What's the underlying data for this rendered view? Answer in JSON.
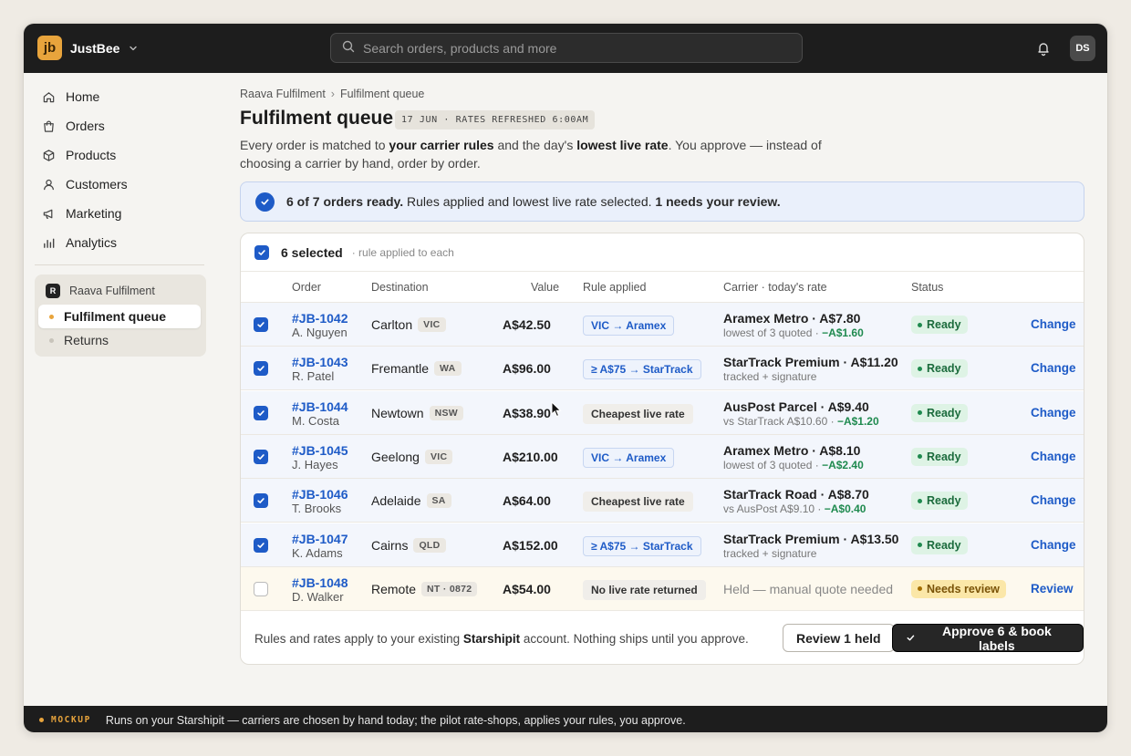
{
  "topbar": {
    "logo_text": "jb",
    "brand": "JustBee",
    "search_placeholder": "Search orders, products and more",
    "avatar": "DS",
    "colors": {
      "bar": "#1d1d1d",
      "logo": "#e8a43c"
    }
  },
  "sidebar": {
    "items": [
      {
        "label": "Home",
        "icon": "home-icon"
      },
      {
        "label": "Orders",
        "icon": "bag-icon"
      },
      {
        "label": "Products",
        "icon": "box-icon"
      },
      {
        "label": "Customers",
        "icon": "person-icon"
      },
      {
        "label": "Marketing",
        "icon": "megaphone-icon"
      },
      {
        "label": "Analytics",
        "icon": "bar-chart-icon"
      }
    ],
    "workspace": {
      "badge": "R",
      "name": "Raava Fulfilment",
      "items": [
        {
          "label": "Fulfilment queue",
          "active": true
        },
        {
          "label": "Returns",
          "active": false
        }
      ]
    }
  },
  "page": {
    "breadcrumb": [
      "Raava Fulfilment",
      "Fulfilment queue"
    ],
    "title": "Fulfilment queue",
    "date_chip": "17 JUN · RATES REFRESHED 6:00AM",
    "desc": {
      "p1": "Every order is matched to ",
      "b1": "your carrier rules",
      "p2": " and the day's ",
      "b2": "lowest live rate",
      "p3": ". You approve — instead of choosing a carrier by hand, order by order."
    },
    "banner": {
      "bold": "6 of 7 orders ready.",
      "text": " Rules applied and lowest live rate selected. ",
      "bold2": "1 needs your review."
    }
  },
  "table": {
    "selected_count": "6 selected",
    "selected_note": "· rule applied to each",
    "headers": {
      "order": "Order",
      "destination": "Destination",
      "value": "Value",
      "rule": "Rule applied",
      "carrier": "Carrier · today's rate",
      "status": "Status"
    },
    "rows": [
      {
        "id": "#JB-1042",
        "customer": "A. Nguyen",
        "city": "Carlton",
        "state": "VIC",
        "value": "A$42.50",
        "rule": "VIC → Aramex",
        "carrier": "Aramex Metro · A$7.80",
        "sub": "lowest of 3 quoted · ",
        "saving": "−A$1.60",
        "status": "Ready",
        "action": "Change"
      },
      {
        "id": "#JB-1043",
        "customer": "R. Patel",
        "city": "Fremantle",
        "state": "WA",
        "value": "A$96.00",
        "rule": "≥ A$75 → StarTrack",
        "carrier": "StarTrack Premium · A$11.20",
        "sub": "tracked + signature",
        "saving": "",
        "status": "Ready",
        "action": "Change"
      },
      {
        "id": "#JB-1044",
        "customer": "M. Costa",
        "city": "Newtown",
        "state": "NSW",
        "value": "A$38.90",
        "rule": "Cheapest live rate",
        "carrier": "AusPost Parcel · A$9.40",
        "sub": "vs StarTrack A$10.60 · ",
        "saving": "−A$1.20",
        "status": "Ready",
        "action": "Change"
      },
      {
        "id": "#JB-1045",
        "customer": "J. Hayes",
        "city": "Geelong",
        "state": "VIC",
        "value": "A$210.00",
        "rule": "VIC → Aramex",
        "carrier": "Aramex Metro · A$8.10",
        "sub": "lowest of 3 quoted · ",
        "saving": "−A$2.40",
        "status": "Ready",
        "action": "Change"
      },
      {
        "id": "#JB-1046",
        "customer": "T. Brooks",
        "city": "Adelaide",
        "state": "SA",
        "value": "A$64.00",
        "rule": "Cheapest live rate",
        "carrier": "StarTrack Road · A$8.70",
        "sub": "vs AusPost A$9.10 · ",
        "saving": "−A$0.40",
        "status": "Ready",
        "action": "Change"
      },
      {
        "id": "#JB-1047",
        "customer": "K. Adams",
        "city": "Cairns",
        "state": "QLD",
        "value": "A$152.00",
        "rule": "≥ A$75 → StarTrack",
        "carrier": "StarTrack Premium · A$13.50",
        "sub": "tracked + signature",
        "saving": "",
        "status": "Ready",
        "action": "Change"
      },
      {
        "id": "#JB-1048",
        "customer": "D. Walker",
        "city": "Remote",
        "state": "NT · 0872",
        "value": "A$54.00",
        "rule": "No live rate returned",
        "carrier": "Held — manual quote needed",
        "sub": "",
        "saving": "",
        "status": "Needs review",
        "action": "Review"
      }
    ],
    "footer": {
      "p1": "Rules and rates apply to your existing ",
      "b1": "Starshipit",
      "p2": " account. Nothing ships until you approve.",
      "secondary": "Review 1 held",
      "primary": "Approve 6 & book labels"
    }
  },
  "bottom": {
    "tag": "MOCKUP",
    "text": "Runs on your Starshipit — carriers are chosen by hand today; the pilot rate-shops, applies your rules, you approve."
  }
}
